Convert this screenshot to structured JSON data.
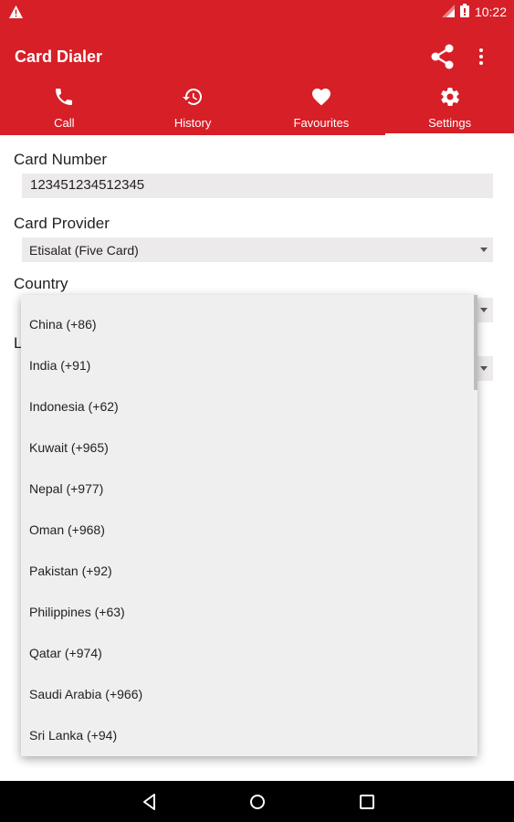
{
  "status_bar": {
    "time": "10:22",
    "icons": [
      "warning-icon",
      "signal-icon",
      "battery-icon"
    ]
  },
  "app": {
    "title": "Card Dialer",
    "actions": [
      "share-icon",
      "more-vert-icon"
    ],
    "colors": {
      "primary": "#d71f27",
      "field_bg": "#eceaea",
      "menu_bg": "#efefef"
    }
  },
  "tabs": [
    {
      "label": "Call",
      "icon": "phone-icon",
      "active": false
    },
    {
      "label": "History",
      "icon": "history-icon",
      "active": false
    },
    {
      "label": "Favourites",
      "icon": "heart-icon",
      "active": false
    },
    {
      "label": "Settings",
      "icon": "gear-icon",
      "active": true
    }
  ],
  "form": {
    "card_number_label": "Card Number",
    "card_number_value": "123451234512345",
    "card_provider_label": "Card Provider",
    "card_provider_value": "Etisalat (Five Card)",
    "country_label": "Country",
    "partial_label": "L"
  },
  "country_dropdown": {
    "options": [
      "China (+86)",
      "India (+91)",
      "Indonesia (+62)",
      "Kuwait (+965)",
      "Nepal (+977)",
      "Oman (+968)",
      "Pakistan (+92)",
      "Philippines (+63)",
      "Qatar (+974)",
      "Saudi Arabia (+966)",
      "Sri Lanka (+94)"
    ]
  },
  "nav_bar": {
    "buttons": [
      "back-icon",
      "home-icon",
      "recents-icon"
    ]
  }
}
